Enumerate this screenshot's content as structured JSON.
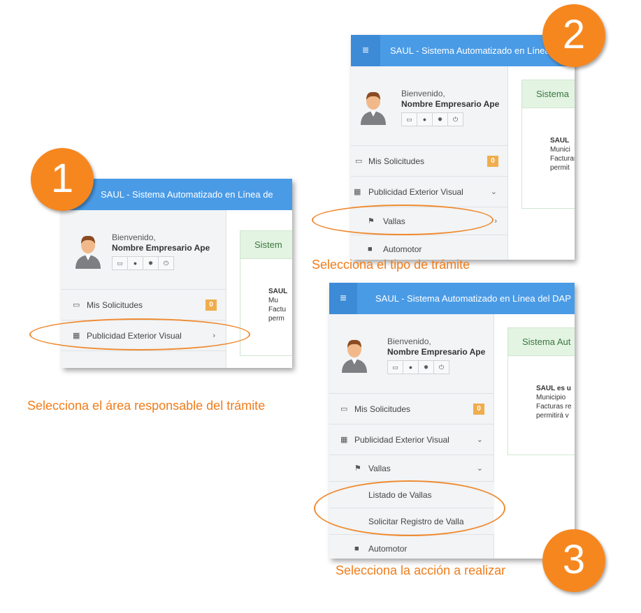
{
  "app": {
    "title_p1": "SAUL - Sistema Automatizado en Línea de",
    "title_p2": "SAUL - Sistema Automatizado en Línea",
    "title_p3": "SAUL - Sistema Automatizado en Línea del DAP",
    "menu_icon": "≡"
  },
  "user": {
    "welcome": "Bienvenido,",
    "name": "Nombre Empresario Ape",
    "icons": [
      "inbox-icon",
      "user-icon",
      "gear-icon",
      "power-icon"
    ]
  },
  "nav": {
    "mis_solicitudes": "Mis Solicitudes",
    "badge": "0",
    "publicidad": "Publicidad Exterior Visual",
    "vallas": "Vallas",
    "automotor": "Automotor",
    "listado": "Listado de Vallas",
    "solicitar": "Solicitar Registro de Valla"
  },
  "content": {
    "header_p1": "Sistem",
    "header_p2": "Sistema",
    "header_p3": "Sistema Aut",
    "body_p1": [
      "SAUL",
      "Mu",
      "Factu",
      "perm"
    ],
    "body_p2": [
      "SAUL",
      "Munici",
      "Facturas",
      "permit"
    ],
    "body_p3": [
      "SAUL es u",
      "Municipio",
      "Facturas re",
      "permitirá v"
    ]
  },
  "steps": {
    "one": "1",
    "two": "2",
    "three": "3"
  },
  "captions": {
    "one": "Selecciona el área responsable del trámite",
    "two": "Selecciona el tipo de trámite",
    "three": "Selecciona la acción a realizar"
  },
  "colors": {
    "topbar": "#4a9be6",
    "accent": "#f6871f",
    "badge": "#f0ad4e"
  }
}
